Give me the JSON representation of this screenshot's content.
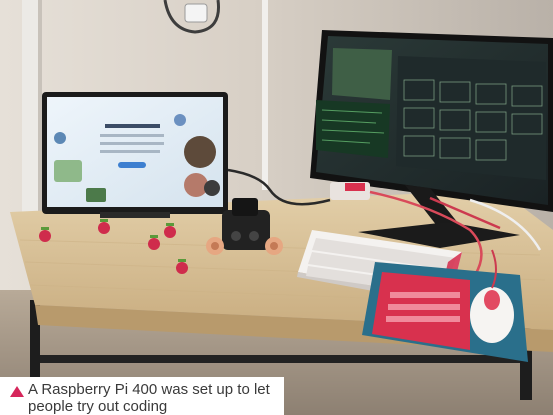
{
  "photo": {
    "subject": "raspberry-pi-400-demo-desk",
    "caption": "A Raspberry Pi 400 was set up to let people try out coding"
  },
  "colors": {
    "caption_triangle": "#d6265b",
    "caption_background": "#ffffff",
    "desk": "#d9c39c",
    "wall": "#d2cabe",
    "keyboard_red": "#d52a4a",
    "mousemat_teal": "#2a6f8b"
  }
}
